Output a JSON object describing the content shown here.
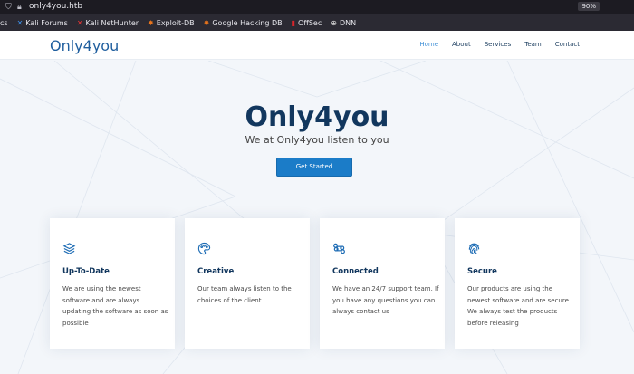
{
  "browser": {
    "url": "only4you.htb",
    "zoom": "90%",
    "bookmarks": [
      {
        "label": "cs",
        "icon": ""
      },
      {
        "label": "Kali Forums",
        "icon": "kali-icon"
      },
      {
        "label": "Kali NetHunter",
        "icon": "kali-icon"
      },
      {
        "label": "Exploit-DB",
        "icon": "exploit-db-icon"
      },
      {
        "label": "Google Hacking DB",
        "icon": "exploit-db-icon"
      },
      {
        "label": "OffSec",
        "icon": "offsec-icon"
      },
      {
        "label": "DNN",
        "icon": "globe-icon"
      }
    ]
  },
  "header": {
    "logo": "Only4you",
    "nav": [
      "Home",
      "About",
      "Services",
      "Team",
      "Contact"
    ],
    "active_nav": "Home"
  },
  "hero": {
    "title": "Only4you",
    "subtitle": "We at Only4you listen to you",
    "cta_label": "Get Started"
  },
  "features": [
    {
      "icon": "layers-icon",
      "title": "Up-To-Date",
      "text": "We are using the newest software and are always updating the software as soon as possible"
    },
    {
      "icon": "palette-icon",
      "title": "Creative",
      "text": "Our team always listen to the choices of the client"
    },
    {
      "icon": "command-icon",
      "title": "Connected",
      "text": "We have an 24/7 support team. If you have any questions you can always contact us"
    },
    {
      "icon": "fingerprint-icon",
      "title": "Secure",
      "text": "Our products are using the newest software and are secure. We always test the products before releasing"
    }
  ],
  "colors": {
    "brand": "#12375e",
    "accent": "#1b7cc8",
    "nav_active": "#3f8fd6",
    "browser_bg": "#1c1b22"
  }
}
